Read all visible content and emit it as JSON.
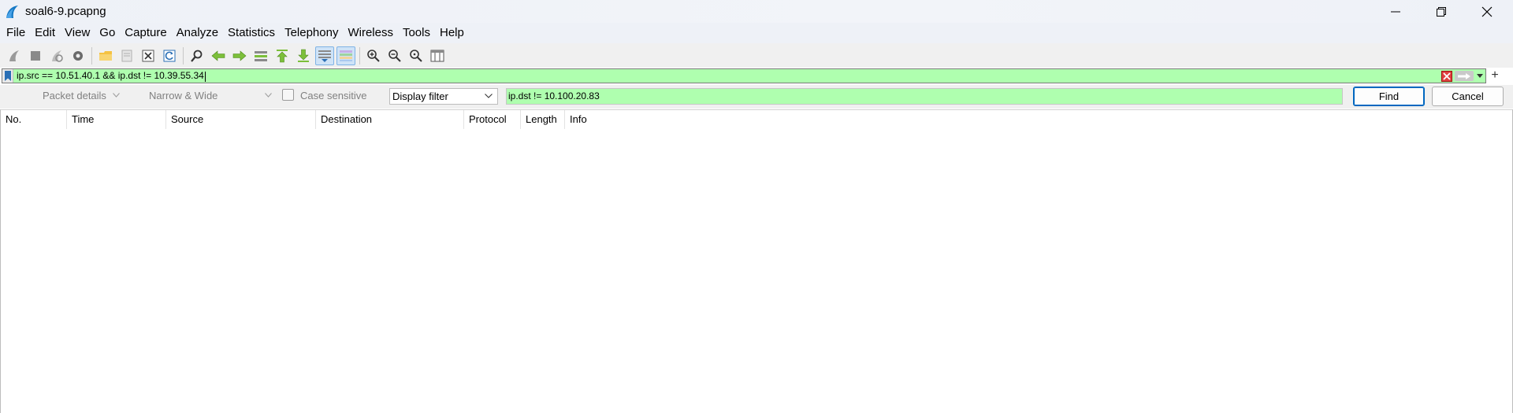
{
  "window": {
    "title": "soal6-9.pcapng"
  },
  "menu": [
    "File",
    "Edit",
    "View",
    "Go",
    "Capture",
    "Analyze",
    "Statistics",
    "Telephony",
    "Wireless",
    "Tools",
    "Help"
  ],
  "toolbar": {
    "icons": [
      "start-capture-icon",
      "stop-capture-icon",
      "restart-capture-icon",
      "capture-options-icon",
      "open-file-icon",
      "save-file-icon",
      "close-file-icon",
      "reload-file-icon",
      "find-packet-icon",
      "go-back-icon",
      "go-forward-icon",
      "go-to-packet-icon",
      "go-first-icon",
      "go-last-icon",
      "autoscroll-icon",
      "colorize-icon",
      "zoom-in-icon",
      "zoom-out-icon",
      "zoom-normal-icon",
      "resize-columns-icon"
    ]
  },
  "display_filter": {
    "value": "ip.src == 10.51.40.1 && ip.dst != 10.39.55.34",
    "background": "#afffaf"
  },
  "find_bar": {
    "search_in": "Packet details",
    "char_width": "Narrow & Wide",
    "case_sensitive_label": "Case sensitive",
    "search_type": "Display filter",
    "search_value": "ip.dst !=  10.100.20.83",
    "find_label": "Find",
    "cancel_label": "Cancel"
  },
  "packet_list": {
    "columns": [
      "No.",
      "Time",
      "Source",
      "Destination",
      "Protocol",
      "Length",
      "Info"
    ],
    "rows": []
  }
}
